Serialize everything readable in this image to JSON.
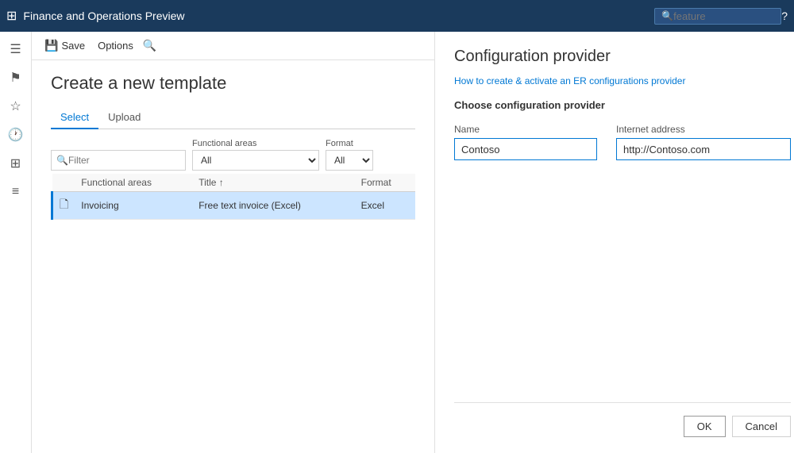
{
  "app": {
    "title": "Finance and Operations Preview",
    "search_placeholder": "feature"
  },
  "command_bar": {
    "save_label": "Save",
    "options_label": "Options"
  },
  "page": {
    "title": "Create a new template"
  },
  "tabs": [
    {
      "label": "Select",
      "active": true
    },
    {
      "label": "Upload",
      "active": false
    }
  ],
  "filters": {
    "filter_placeholder": "Filter",
    "functional_areas_label": "Functional areas",
    "functional_areas_value": "All",
    "format_label": "Format",
    "format_value": "All"
  },
  "table": {
    "columns": [
      {
        "label": ""
      },
      {
        "label": "Functional areas"
      },
      {
        "label": "Title ↑"
      },
      {
        "label": "Format"
      }
    ],
    "rows": [
      {
        "icon": "📄",
        "functional_areas": "Invoicing",
        "title": "Free text invoice (Excel)",
        "format": "Excel",
        "selected": true
      }
    ]
  },
  "right_panel": {
    "title": "Configuration provider",
    "link_text": "How to create & activate an ER configurations provider",
    "section_label": "Choose configuration provider",
    "name_label": "Name",
    "name_value": "Contoso",
    "internet_address_label": "Internet address",
    "internet_address_value": "http://Contoso.com",
    "ok_label": "OK",
    "cancel_label": "Cancel"
  },
  "sidebar": {
    "items": [
      {
        "icon": "☰",
        "name": "hamburger"
      },
      {
        "icon": "⚐",
        "name": "favorites"
      },
      {
        "icon": "★",
        "name": "star"
      },
      {
        "icon": "🕐",
        "name": "recent"
      },
      {
        "icon": "⊞",
        "name": "workspaces"
      },
      {
        "icon": "≡",
        "name": "modules"
      }
    ]
  }
}
